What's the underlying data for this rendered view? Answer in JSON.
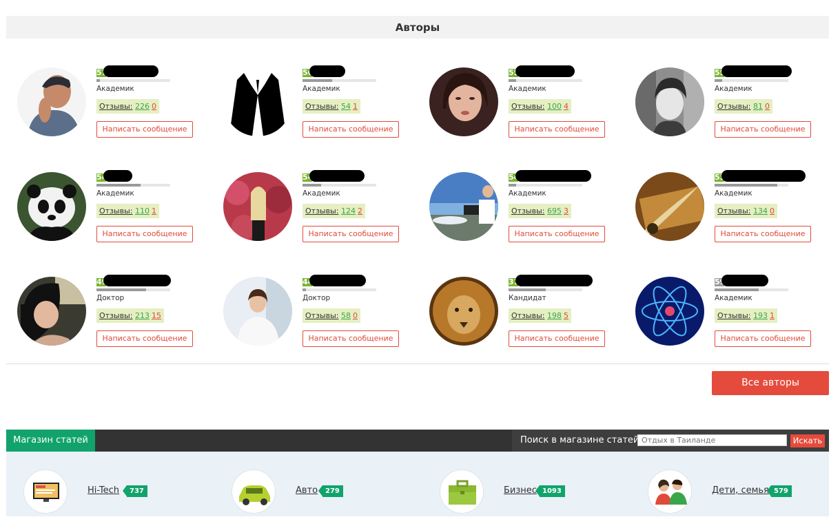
{
  "authors": {
    "title": "Авторы",
    "message_label": "Написать сообщение",
    "reviews_label": "Отзывы:",
    "all_authors_label": "Все авторы",
    "cards": [
      {
        "level": "57",
        "rank": "Академик",
        "pos": "226",
        "neg": "0",
        "avatar": "man-photo-avatar",
        "bar_level": 0.05
      },
      {
        "level": "56",
        "rank": "Академик",
        "pos": "54",
        "neg": "1",
        "avatar": "suit-icon",
        "bar_level": 0.4
      },
      {
        "level": "55",
        "rank": "Академик",
        "pos": "100",
        "neg": "4",
        "avatar": "woman-portrait-avatar",
        "bar_level": 0.1
      },
      {
        "level": "55",
        "rank": "Академик",
        "pos": "81",
        "neg": "0",
        "avatar": "cartoon-woman-avatar",
        "bar_level": 0.1
      },
      {
        "level": "54",
        "rank": "Академик",
        "pos": "110",
        "neg": "1",
        "avatar": "panda-avatar",
        "bar_level": 0.6
      },
      {
        "level": "54",
        "rank": "Академик",
        "pos": "124",
        "neg": "2",
        "avatar": "woman-flowers-avatar",
        "bar_level": 0.25
      },
      {
        "level": "54",
        "rank": "Академик",
        "pos": "695",
        "neg": "3",
        "avatar": "beach-laptop-avatar",
        "bar_level": 0.1
      },
      {
        "level": "53",
        "rank": "Академик",
        "pos": "134",
        "neg": "0",
        "avatar": "quill-pen-avatar",
        "bar_level": 0.85
      },
      {
        "level": "49",
        "rank": "Доктор",
        "pos": "213",
        "neg": "15",
        "avatar": "woman-dark-hair-avatar",
        "bar_level": 0.67
      },
      {
        "level": "44",
        "rank": "Доктор",
        "pos": "58",
        "neg": "0",
        "avatar": "business-woman-avatar",
        "bar_level": 0.05
      },
      {
        "level": "31",
        "rank": "Кандидат",
        "pos": "198",
        "neg": "5",
        "avatar": "lion-avatar",
        "bar_level": 0.5
      },
      {
        "level": "59",
        "rank": "Академик",
        "pos": "193",
        "neg": "1",
        "avatar": "atom-avatar",
        "bar_level": 0.6,
        "grey": true
      }
    ]
  },
  "shop": {
    "tab_label": "Магазин статей",
    "search_label": "Поиск в магазине статей:",
    "search_placeholder": "Отдых в Таиланде",
    "search_button": "Искать",
    "categories": [
      {
        "name": "Hi-Tech",
        "count": "737",
        "icon": "monitor-icon"
      },
      {
        "name": "Авто",
        "count": "279",
        "icon": "car-icon"
      },
      {
        "name": "Бизнес",
        "count": "1093",
        "icon": "briefcase-icon"
      },
      {
        "name": "Дети, семья",
        "count": "579",
        "icon": "family-icon"
      }
    ]
  },
  "colors": {
    "accent_green": "#11a36b",
    "accent_red": "#e54b3c",
    "level_green": "#7ab42f"
  }
}
